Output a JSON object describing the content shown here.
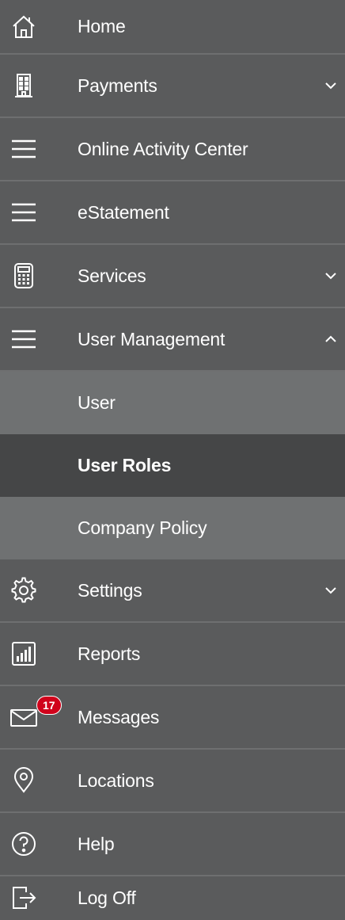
{
  "nav": {
    "items": [
      {
        "label": "Home",
        "icon": "home-icon"
      },
      {
        "label": "Payments",
        "icon": "building-icon",
        "chevron": "down"
      },
      {
        "label": "Online Activity Center",
        "icon": "menu-lines-icon"
      },
      {
        "label": "eStatement",
        "icon": "menu-lines-icon"
      },
      {
        "label": "Services",
        "icon": "calculator-icon",
        "chevron": "down"
      },
      {
        "label": "User Management",
        "icon": "menu-lines-icon",
        "chevron": "up",
        "expanded": true
      }
    ],
    "user_management_sub": [
      {
        "label": "User"
      },
      {
        "label": "User Roles",
        "active": true
      },
      {
        "label": "Company Policy"
      }
    ],
    "items_after": [
      {
        "label": "Settings",
        "icon": "gear-icon",
        "chevron": "down"
      },
      {
        "label": "Reports",
        "icon": "bar-chart-icon"
      },
      {
        "label": "Messages",
        "icon": "envelope-icon",
        "badge": "17"
      },
      {
        "label": "Locations",
        "icon": "location-pin-icon"
      },
      {
        "label": "Help",
        "icon": "help-circle-icon"
      },
      {
        "label": "Log Off",
        "icon": "logout-icon"
      }
    ]
  },
  "colors": {
    "background": "#5a5b5c",
    "submenu_bg": "#6f7172",
    "active_bg": "#454647",
    "divider": "#6e6f70",
    "badge": "#d0021b",
    "text": "#ffffff"
  }
}
